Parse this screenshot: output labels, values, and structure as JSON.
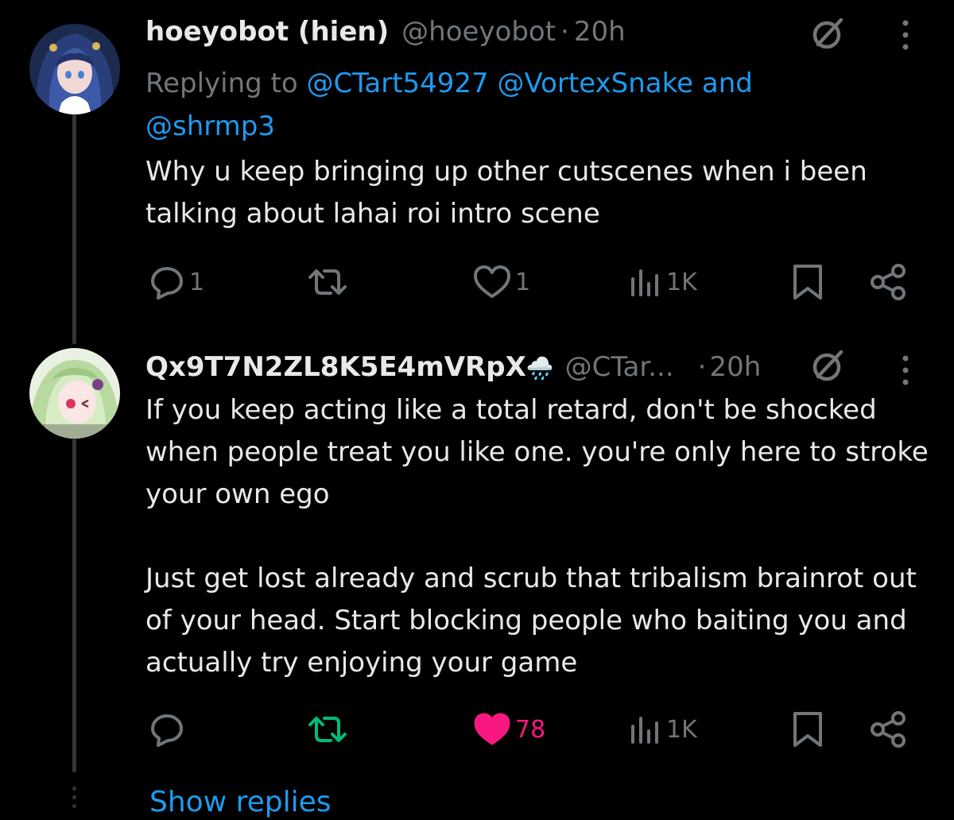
{
  "tweet1": {
    "name": "hoeyobot (hien)",
    "handle": "@hoeyobot",
    "separator": "·",
    "time": "20h",
    "replying_prefix": "Replying to",
    "mention_1": "@CTart54927",
    "mention_2": "@VortexSnake",
    "and_word": "and",
    "mention_3": "@shrmp3",
    "text": "Why u keep bringing up other cutscenes when i been talking about lahai roi intro scene",
    "replies": "1",
    "likes": "1",
    "views": "1K"
  },
  "tweet2": {
    "name": "Qx9T7N2ZL8K5E4mVRpX",
    "name_emoji": "🌧️",
    "handle": "@CTar...",
    "separator": "·",
    "time": "20h",
    "text": "If you keep acting like a total retard, don't be shocked when people treat you like one. you're only here to stroke your own ego\n\nJust get lost already and scrub that tribalism brainrot out of your head. Start blocking people who baiting you and actually try enjoying your game",
    "likes": "78",
    "views": "1K"
  },
  "footer": {
    "show_replies": "Show replies"
  },
  "icons": {
    "reply": "reply-icon",
    "retweet": "retweet-icon",
    "like": "heart-icon",
    "views": "views-icon",
    "bookmark": "bookmark-icon",
    "share": "share-icon",
    "block": "block-icon",
    "more": "more-icon"
  },
  "colors": {
    "background": "#000000",
    "text": "#e7e9ea",
    "muted": "#71767b",
    "link": "#1d9bf0",
    "like": "#f91880",
    "retweet": "#00ba7c"
  }
}
